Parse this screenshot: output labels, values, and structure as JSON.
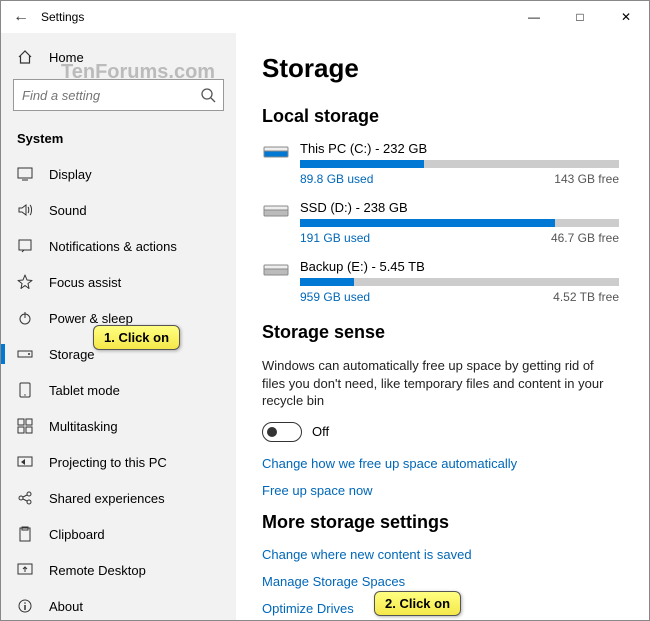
{
  "window": {
    "title": "Settings"
  },
  "watermark": "TenForums.com",
  "sidebar": {
    "home": "Home",
    "search_placeholder": "Find a setting",
    "section": "System",
    "items": [
      {
        "label": "Display"
      },
      {
        "label": "Sound"
      },
      {
        "label": "Notifications & actions"
      },
      {
        "label": "Focus assist"
      },
      {
        "label": "Power & sleep"
      },
      {
        "label": "Storage"
      },
      {
        "label": "Tablet mode"
      },
      {
        "label": "Multitasking"
      },
      {
        "label": "Projecting to this PC"
      },
      {
        "label": "Shared experiences"
      },
      {
        "label": "Clipboard"
      },
      {
        "label": "Remote Desktop"
      },
      {
        "label": "About"
      }
    ]
  },
  "page": {
    "title": "Storage",
    "local_heading": "Local storage",
    "drives": [
      {
        "title": "This PC (C:) - 232 GB",
        "used": "89.8 GB used",
        "free": "143 GB free",
        "pct": 39
      },
      {
        "title": "SSD (D:) - 238 GB",
        "used": "191 GB used",
        "free": "46.7 GB free",
        "pct": 80
      },
      {
        "title": "Backup (E:) - 5.45 TB",
        "used": "959 GB used",
        "free": "4.52 TB free",
        "pct": 17
      }
    ],
    "sense_heading": "Storage sense",
    "sense_desc": "Windows can automatically free up space by getting rid of files you don't need, like temporary files and content in your recycle bin",
    "toggle_state": "Off",
    "link_change_auto": "Change how we free up space automatically",
    "link_free_now": "Free up space now",
    "more_heading": "More storage settings",
    "link_new_content": "Change where new content is saved",
    "link_spaces": "Manage Storage Spaces",
    "link_optimize": "Optimize Drives"
  },
  "callouts": {
    "c1": "1. Click on",
    "c2": "2. Click on"
  }
}
